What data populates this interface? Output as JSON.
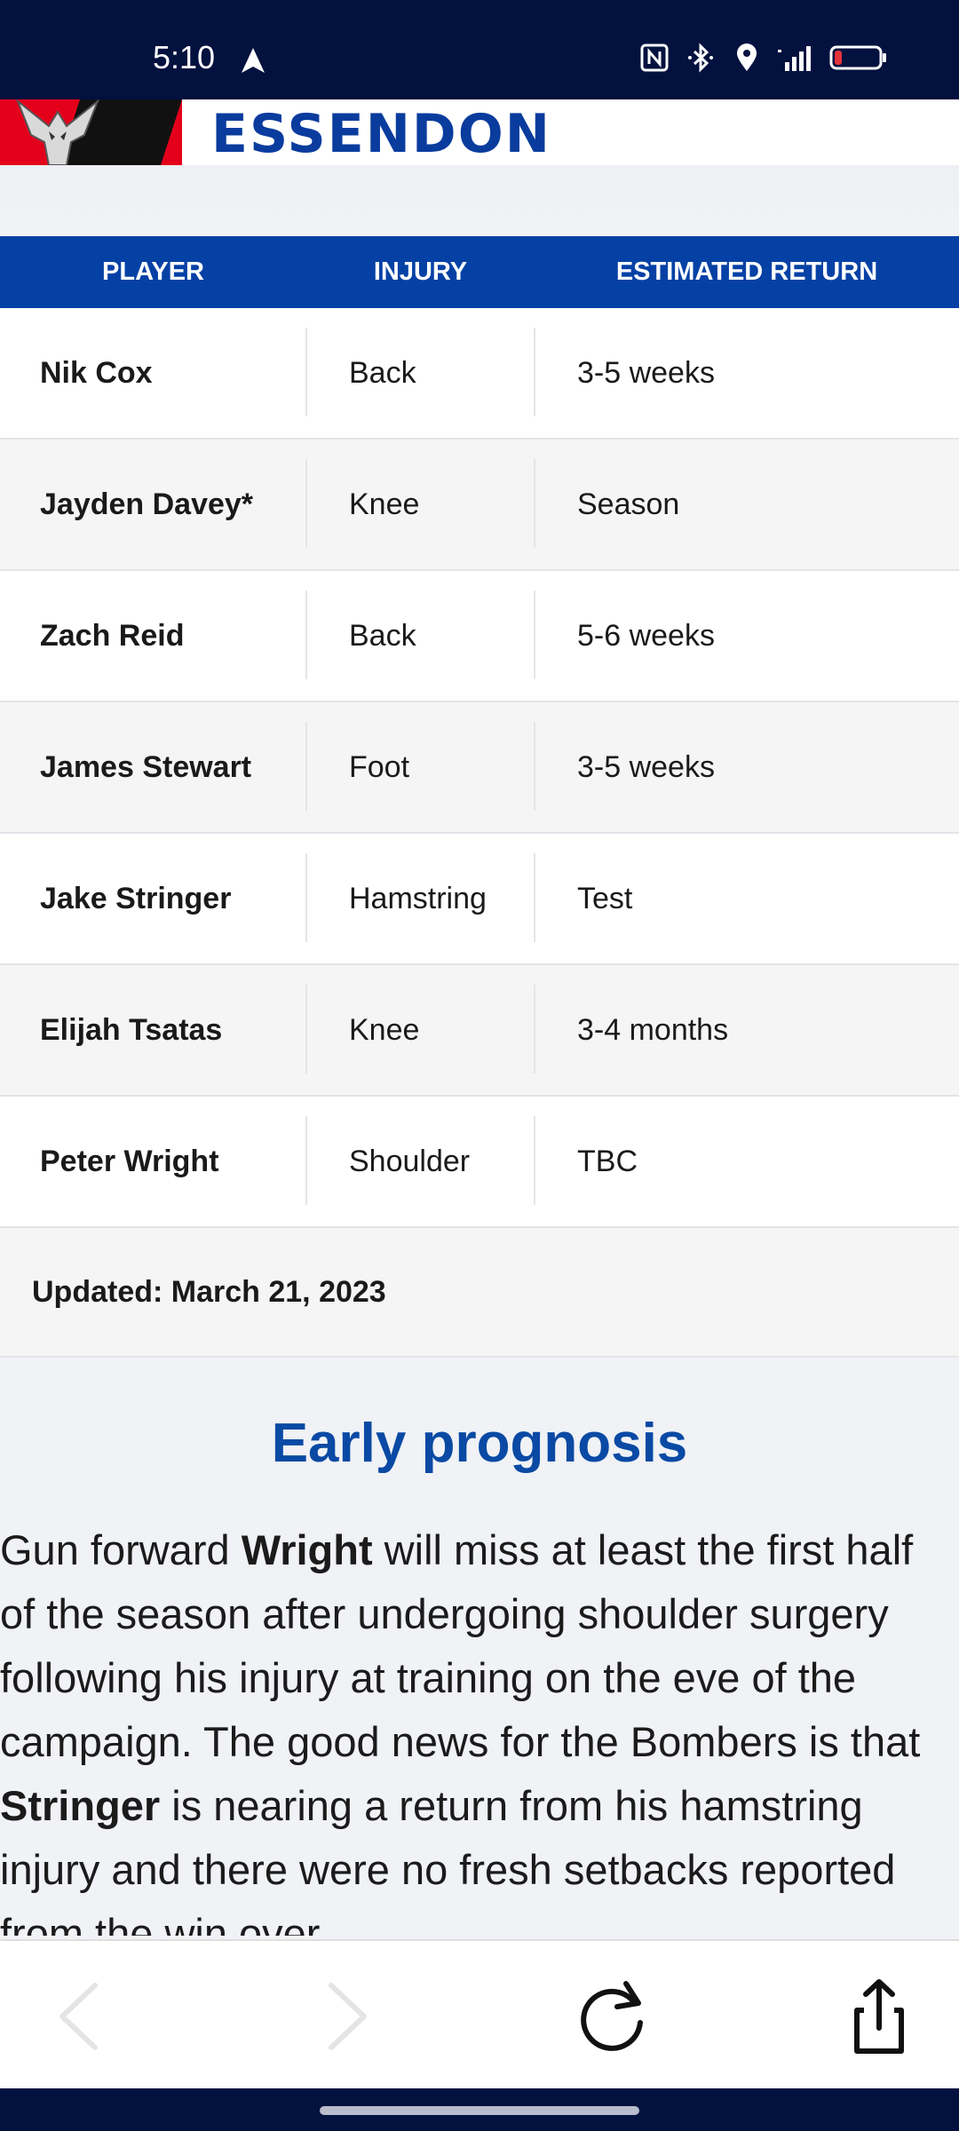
{
  "status_bar": {
    "time": "5:10"
  },
  "header": {
    "wordmark": "ESSENDON"
  },
  "table": {
    "columns": [
      "PLAYER",
      "INJURY",
      "ESTIMATED RETURN"
    ],
    "rows": [
      {
        "player": "Nik Cox",
        "injury": "Back",
        "return": "3-5 weeks"
      },
      {
        "player": "Jayden Davey*",
        "injury": "Knee",
        "return": "Season"
      },
      {
        "player": "Zach Reid",
        "injury": "Back",
        "return": "5-6 weeks"
      },
      {
        "player": "James Stewart",
        "injury": "Foot",
        "return": "3-5 weeks"
      },
      {
        "player": "Jake Stringer",
        "injury": "Hamstring",
        "return": "Test"
      },
      {
        "player": "Elijah Tsatas",
        "injury": "Knee",
        "return": "3-4 months"
      },
      {
        "player": "Peter Wright",
        "injury": "Shoulder",
        "return": "TBC"
      }
    ],
    "updated": "Updated: March 21, 2023"
  },
  "article": {
    "heading": "Early prognosis",
    "p1": "Gun forward ",
    "b1": "Wright",
    "p2": " will miss at least the first half of the season after undergoing shoulder surgery following his injury at training on the eve of the campaign. The good news for the Bombers is that ",
    "b2": "Stringer",
    "p3": " is nearing a return from his hamstring injury and there were no fresh setbacks reported from the win over"
  },
  "colors": {
    "brand_blue": "#0541a5",
    "heading_blue": "#0a4aa4",
    "status_bar": "#03113f",
    "brand_red": "#e4001b"
  },
  "icons": [
    "navigation-arrow-icon",
    "nfc-icon",
    "bluetooth-icon",
    "location-icon",
    "signal-4g-icon",
    "battery-icon",
    "back-icon",
    "forward-icon",
    "reload-icon",
    "share-icon"
  ]
}
